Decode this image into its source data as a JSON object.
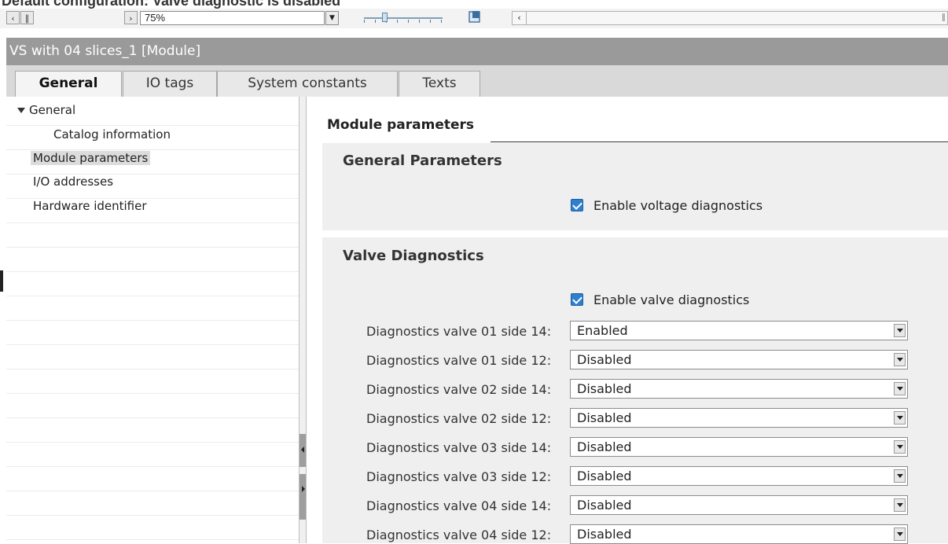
{
  "caption": "Default configuration: Valve diagnostic is disabled",
  "toolbar": {
    "zoom_value": "75%"
  },
  "window": {
    "title": "VS with 04 slices_1 [Module]"
  },
  "tabs": [
    {
      "label": "General",
      "active": true
    },
    {
      "label": "IO tags",
      "active": false
    },
    {
      "label": "System constants",
      "active": false
    },
    {
      "label": "Texts",
      "active": false
    }
  ],
  "tree": {
    "items": [
      {
        "label": "General",
        "expanded": true
      },
      {
        "label": "Catalog information"
      },
      {
        "label": "Module parameters",
        "selected": true
      },
      {
        "label": "I/O addresses"
      },
      {
        "label": "Hardware identifier"
      }
    ]
  },
  "content": {
    "section_title": "Module parameters",
    "general_group": {
      "title": "General Parameters",
      "voltage_checkbox": {
        "label": "Enable voltage diagnostics",
        "checked": true
      }
    },
    "valve_group": {
      "title": "Valve Diagnostics",
      "valve_checkbox": {
        "label": "Enable valve diagnostics",
        "checked": true
      },
      "params": [
        {
          "label": "Diagnostics valve 01 side 14:",
          "value": "Enabled"
        },
        {
          "label": "Diagnostics valve 01 side 12:",
          "value": "Disabled"
        },
        {
          "label": "Diagnostics valve 02 side 14:",
          "value": "Disabled"
        },
        {
          "label": "Diagnostics valve 02 side 12:",
          "value": "Disabled"
        },
        {
          "label": "Diagnostics valve 03 side 14:",
          "value": "Disabled"
        },
        {
          "label": "Diagnostics valve 03 side 12:",
          "value": "Disabled"
        },
        {
          "label": "Diagnostics valve 04 side 14:",
          "value": "Disabled"
        },
        {
          "label": "Diagnostics valve 04 side 12:",
          "value": "Disabled"
        }
      ]
    }
  },
  "colors": {
    "title_bar": "#9a9a9a",
    "group_bg": "#efefef",
    "checkbox_accent": "#2f7fd0"
  }
}
